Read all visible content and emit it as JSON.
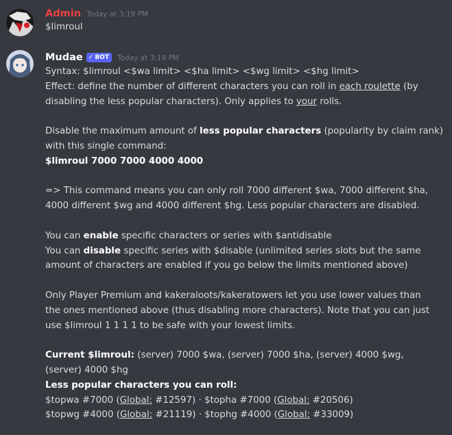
{
  "messages": [
    {
      "author": "Admin",
      "author_color": "#ed4245",
      "timestamp": "Today at 3:19 PM",
      "text": "$limroul"
    },
    {
      "author": "Mudae",
      "author_color": "#ffffff",
      "bot_tag": "BOT",
      "timestamp": "Today at 3:19 PM",
      "syntax": "Syntax: $limroul <$wa limit> <$ha limit> <$wg limit> <$hg limit>",
      "effect_pre": "Effect: define the number of different characters you can roll in ",
      "effect_u1": "each roulette",
      "effect_mid": " (by",
      "effect_l2_pre": "disabling the less popular characters). Only applies to ",
      "effect_u2": "your",
      "effect_l2_post": " rolls.",
      "disable_pre": "Disable the maximum amount of ",
      "disable_bold": "less popular characters",
      "disable_post": " (popularity by claim rank)",
      "disable_l2": "with this single command:",
      "command": "$limroul 7000 7000 4000 4000",
      "means_l1": "=> This command means you can only roll 7000 different $wa, 7000 different $ha,",
      "means_l2": "4000 different $wg and 4000 different $hg. Less popular characters are disabled.",
      "enable_pre": "You can ",
      "enable_bold": "enable",
      "enable_post": " specific characters or series with $antidisable",
      "disable2_pre": "You can ",
      "disable2_bold": "disable",
      "disable2_post": " specific series with $disable (unlimited series slots but the same",
      "disable2_l2": "amount of characters are enabled if you go below the limits mentioned above)",
      "premium_l1": "Only Player Premium and kakeraloots/kakeratowers let you use lower values than",
      "premium_l2": "the ones mentioned above (thus disabling more characters). Note that you can just",
      "premium_l3": "use $limroul 1 1 1 1 to be safe with your lowest limits.",
      "current_bold": "Current $limroul:",
      "current_post": " (server) 7000 $wa, (server) 7000 $ha, (server) 4000 $wg,",
      "current_l2": "(server) 4000 $hg",
      "less_popular_bold": "Less popular characters you can roll:",
      "row1": {
        "a": "$topwa #7000 (",
        "global1": "Global:",
        "b": " #12597) · $topha #7000 (",
        "global2": "Global:",
        "c": " #20506)"
      },
      "row2": {
        "a": "$topwg #4000 (",
        "global1": "Global:",
        "b": " #21119) · $tophg #4000 (",
        "global2": "Global:",
        "c": " #33009)"
      }
    }
  ],
  "icons": {
    "avatar_admin": "admin-avatar",
    "avatar_mudae": "mudae-avatar",
    "bot_check": "checkmark-icon"
  }
}
